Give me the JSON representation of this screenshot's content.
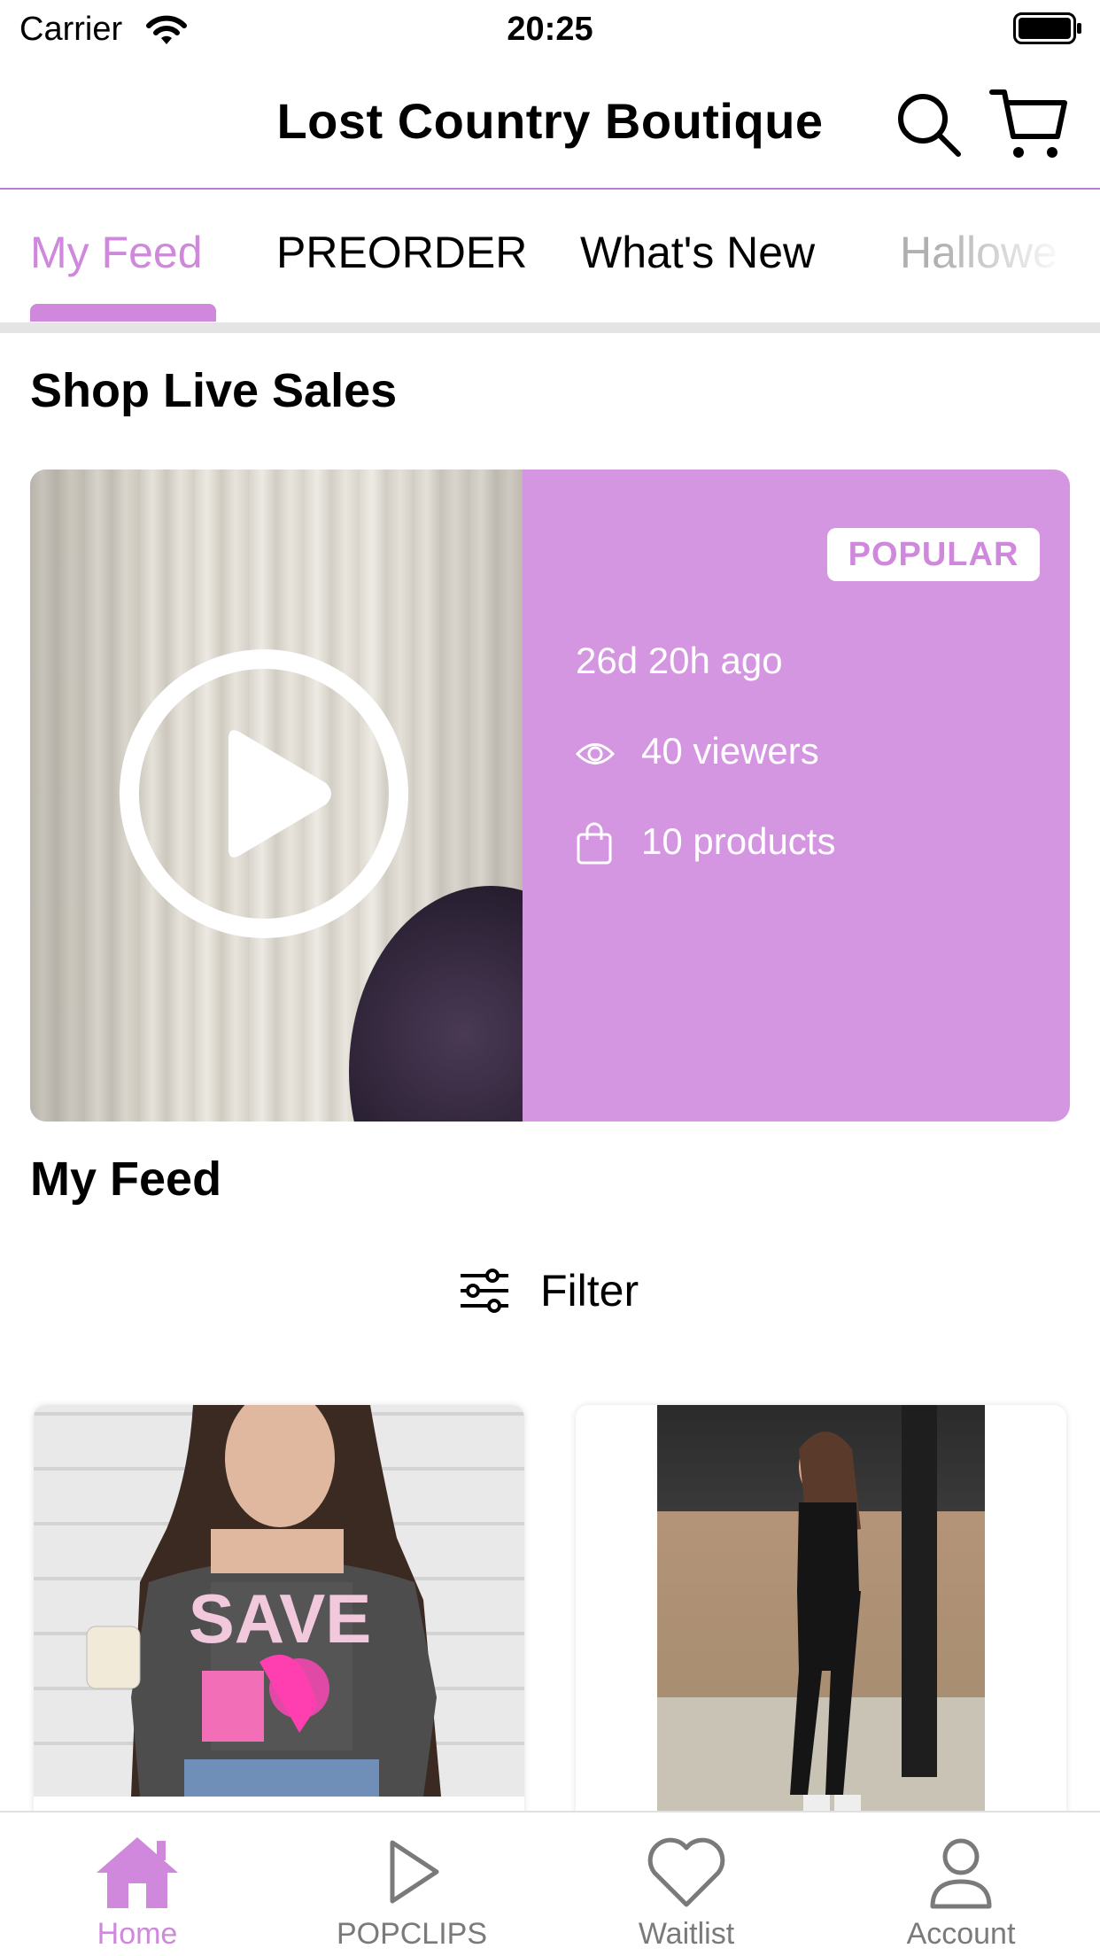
{
  "status_bar": {
    "carrier": "Carrier",
    "time": "20:25"
  },
  "header": {
    "title": "Lost Country Boutique",
    "icons": [
      "search-icon",
      "cart-icon"
    ]
  },
  "tabs": [
    {
      "label": "My Feed",
      "active": true
    },
    {
      "label": "PREORDER",
      "active": false
    },
    {
      "label": "What's New",
      "active": false
    },
    {
      "label": "Hallowe",
      "active": false
    }
  ],
  "live_section": {
    "title": "Shop Live Sales",
    "card": {
      "badge": "POPULAR",
      "time_ago": "26d 20h ago",
      "viewers": "40 viewers",
      "products": "10 products",
      "icons": [
        "play-icon",
        "eye-icon",
        "bag-icon"
      ]
    }
  },
  "feed_section": {
    "title": "My Feed",
    "filter_label": "Filter"
  },
  "products": [
    {
      "image_alt": "Woman in gray tee with pink ghost ribbon graphic"
    },
    {
      "image_alt": "Woman in black tank and leggings"
    }
  ],
  "bottom_nav": [
    {
      "label": "Home",
      "icon": "home-icon",
      "active": true
    },
    {
      "label": "POPCLIPS",
      "icon": "play-outline-icon",
      "active": false
    },
    {
      "label": "Waitlist",
      "icon": "heart-icon",
      "active": false
    },
    {
      "label": "Account",
      "icon": "person-icon",
      "active": false
    }
  ],
  "colors": {
    "accent": "#cf88dc",
    "card_bg": "#d496e0",
    "nav_inactive": "#7a7a7a"
  }
}
